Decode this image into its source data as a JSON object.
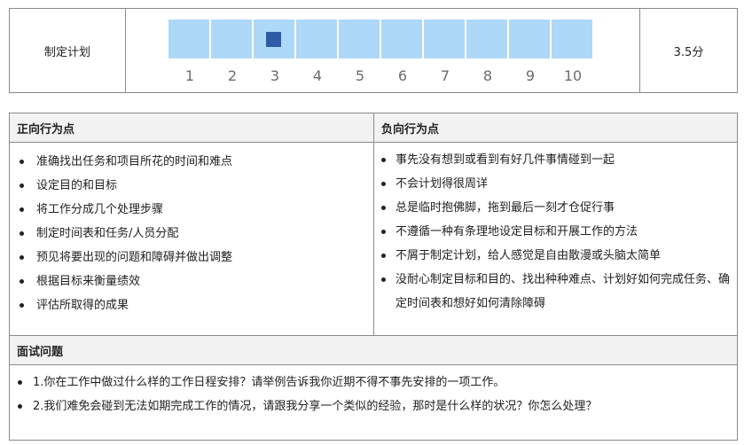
{
  "rating": {
    "label": "制定计划",
    "scale_numbers": [
      "1",
      "2",
      "3",
      "4",
      "5",
      "6",
      "7",
      "8",
      "9",
      "10"
    ],
    "selected_segment": 3,
    "score": "3.5分"
  },
  "table": {
    "positive_header": "正向行为点",
    "negative_header": "负向行为点",
    "positive_items": [
      "准确找出任务和项目所花的时间和难点",
      "设定目的和目标",
      "将工作分成几个处理步骤",
      "制定时间表和任务/人员分配",
      "预见将要出现的问题和障碍并做出调整",
      "根据目标来衡量绩效",
      "评估所取得的成果"
    ],
    "negative_items": [
      "事先没有想到或看到有好几件事情碰到一起",
      "不会计划得很周详",
      "总是临时抱佛脚，拖到最后一刻才仓促行事",
      "不遵循一种有条理地设定目标和开展工作的方法",
      "不屑于制定计划，给人感觉是自由散漫或头脑太简单",
      "没耐心制定目标和目的、找出种种难点、计划好如何完成任务、确定时间表和想好如何清除障碍"
    ],
    "questions_header": "面试问题",
    "questions": [
      "1.你在工作中做过什么样的工作日程安排？请举例告诉我你近期不得不事先安排的一项工作。",
      "2.我们难免会碰到无法如期完成工作的情况，请跟我分享一个类似的经验，那时是什么样的状况？你怎么处理？"
    ]
  },
  "colors": {
    "scale_segment": "#add8f7",
    "scale_marker": "#2e5aa6",
    "border": "#8a8a8a",
    "header_bg": "#f2f2f2"
  }
}
